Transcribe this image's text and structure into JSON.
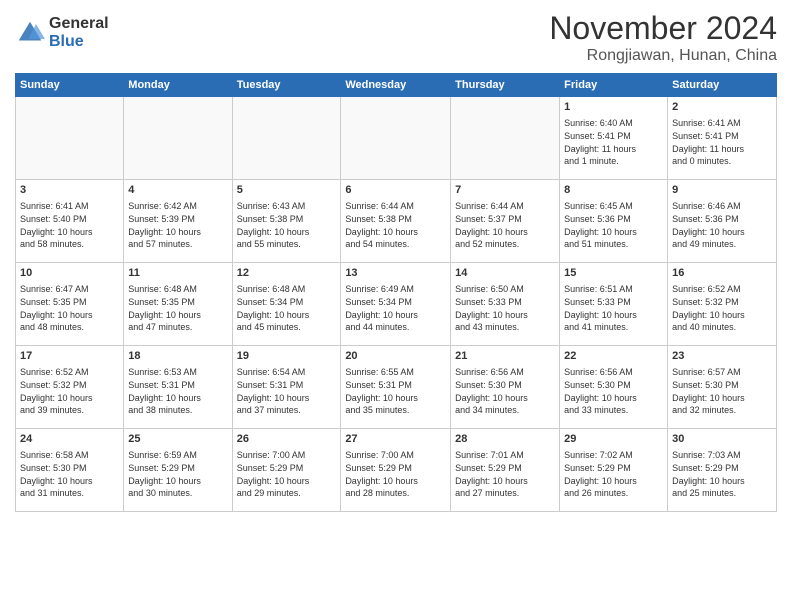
{
  "header": {
    "logo_general": "General",
    "logo_blue": "Blue",
    "month_title": "November 2024",
    "location": "Rongjiawan, Hunan, China"
  },
  "days_of_week": [
    "Sunday",
    "Monday",
    "Tuesday",
    "Wednesday",
    "Thursday",
    "Friday",
    "Saturday"
  ],
  "weeks": [
    [
      {
        "day": "",
        "info": ""
      },
      {
        "day": "",
        "info": ""
      },
      {
        "day": "",
        "info": ""
      },
      {
        "day": "",
        "info": ""
      },
      {
        "day": "",
        "info": ""
      },
      {
        "day": "1",
        "info": "Sunrise: 6:40 AM\nSunset: 5:41 PM\nDaylight: 11 hours\nand 1 minute."
      },
      {
        "day": "2",
        "info": "Sunrise: 6:41 AM\nSunset: 5:41 PM\nDaylight: 11 hours\nand 0 minutes."
      }
    ],
    [
      {
        "day": "3",
        "info": "Sunrise: 6:41 AM\nSunset: 5:40 PM\nDaylight: 10 hours\nand 58 minutes."
      },
      {
        "day": "4",
        "info": "Sunrise: 6:42 AM\nSunset: 5:39 PM\nDaylight: 10 hours\nand 57 minutes."
      },
      {
        "day": "5",
        "info": "Sunrise: 6:43 AM\nSunset: 5:38 PM\nDaylight: 10 hours\nand 55 minutes."
      },
      {
        "day": "6",
        "info": "Sunrise: 6:44 AM\nSunset: 5:38 PM\nDaylight: 10 hours\nand 54 minutes."
      },
      {
        "day": "7",
        "info": "Sunrise: 6:44 AM\nSunset: 5:37 PM\nDaylight: 10 hours\nand 52 minutes."
      },
      {
        "day": "8",
        "info": "Sunrise: 6:45 AM\nSunset: 5:36 PM\nDaylight: 10 hours\nand 51 minutes."
      },
      {
        "day": "9",
        "info": "Sunrise: 6:46 AM\nSunset: 5:36 PM\nDaylight: 10 hours\nand 49 minutes."
      }
    ],
    [
      {
        "day": "10",
        "info": "Sunrise: 6:47 AM\nSunset: 5:35 PM\nDaylight: 10 hours\nand 48 minutes."
      },
      {
        "day": "11",
        "info": "Sunrise: 6:48 AM\nSunset: 5:35 PM\nDaylight: 10 hours\nand 47 minutes."
      },
      {
        "day": "12",
        "info": "Sunrise: 6:48 AM\nSunset: 5:34 PM\nDaylight: 10 hours\nand 45 minutes."
      },
      {
        "day": "13",
        "info": "Sunrise: 6:49 AM\nSunset: 5:34 PM\nDaylight: 10 hours\nand 44 minutes."
      },
      {
        "day": "14",
        "info": "Sunrise: 6:50 AM\nSunset: 5:33 PM\nDaylight: 10 hours\nand 43 minutes."
      },
      {
        "day": "15",
        "info": "Sunrise: 6:51 AM\nSunset: 5:33 PM\nDaylight: 10 hours\nand 41 minutes."
      },
      {
        "day": "16",
        "info": "Sunrise: 6:52 AM\nSunset: 5:32 PM\nDaylight: 10 hours\nand 40 minutes."
      }
    ],
    [
      {
        "day": "17",
        "info": "Sunrise: 6:52 AM\nSunset: 5:32 PM\nDaylight: 10 hours\nand 39 minutes."
      },
      {
        "day": "18",
        "info": "Sunrise: 6:53 AM\nSunset: 5:31 PM\nDaylight: 10 hours\nand 38 minutes."
      },
      {
        "day": "19",
        "info": "Sunrise: 6:54 AM\nSunset: 5:31 PM\nDaylight: 10 hours\nand 37 minutes."
      },
      {
        "day": "20",
        "info": "Sunrise: 6:55 AM\nSunset: 5:31 PM\nDaylight: 10 hours\nand 35 minutes."
      },
      {
        "day": "21",
        "info": "Sunrise: 6:56 AM\nSunset: 5:30 PM\nDaylight: 10 hours\nand 34 minutes."
      },
      {
        "day": "22",
        "info": "Sunrise: 6:56 AM\nSunset: 5:30 PM\nDaylight: 10 hours\nand 33 minutes."
      },
      {
        "day": "23",
        "info": "Sunrise: 6:57 AM\nSunset: 5:30 PM\nDaylight: 10 hours\nand 32 minutes."
      }
    ],
    [
      {
        "day": "24",
        "info": "Sunrise: 6:58 AM\nSunset: 5:30 PM\nDaylight: 10 hours\nand 31 minutes."
      },
      {
        "day": "25",
        "info": "Sunrise: 6:59 AM\nSunset: 5:29 PM\nDaylight: 10 hours\nand 30 minutes."
      },
      {
        "day": "26",
        "info": "Sunrise: 7:00 AM\nSunset: 5:29 PM\nDaylight: 10 hours\nand 29 minutes."
      },
      {
        "day": "27",
        "info": "Sunrise: 7:00 AM\nSunset: 5:29 PM\nDaylight: 10 hours\nand 28 minutes."
      },
      {
        "day": "28",
        "info": "Sunrise: 7:01 AM\nSunset: 5:29 PM\nDaylight: 10 hours\nand 27 minutes."
      },
      {
        "day": "29",
        "info": "Sunrise: 7:02 AM\nSunset: 5:29 PM\nDaylight: 10 hours\nand 26 minutes."
      },
      {
        "day": "30",
        "info": "Sunrise: 7:03 AM\nSunset: 5:29 PM\nDaylight: 10 hours\nand 25 minutes."
      }
    ]
  ]
}
